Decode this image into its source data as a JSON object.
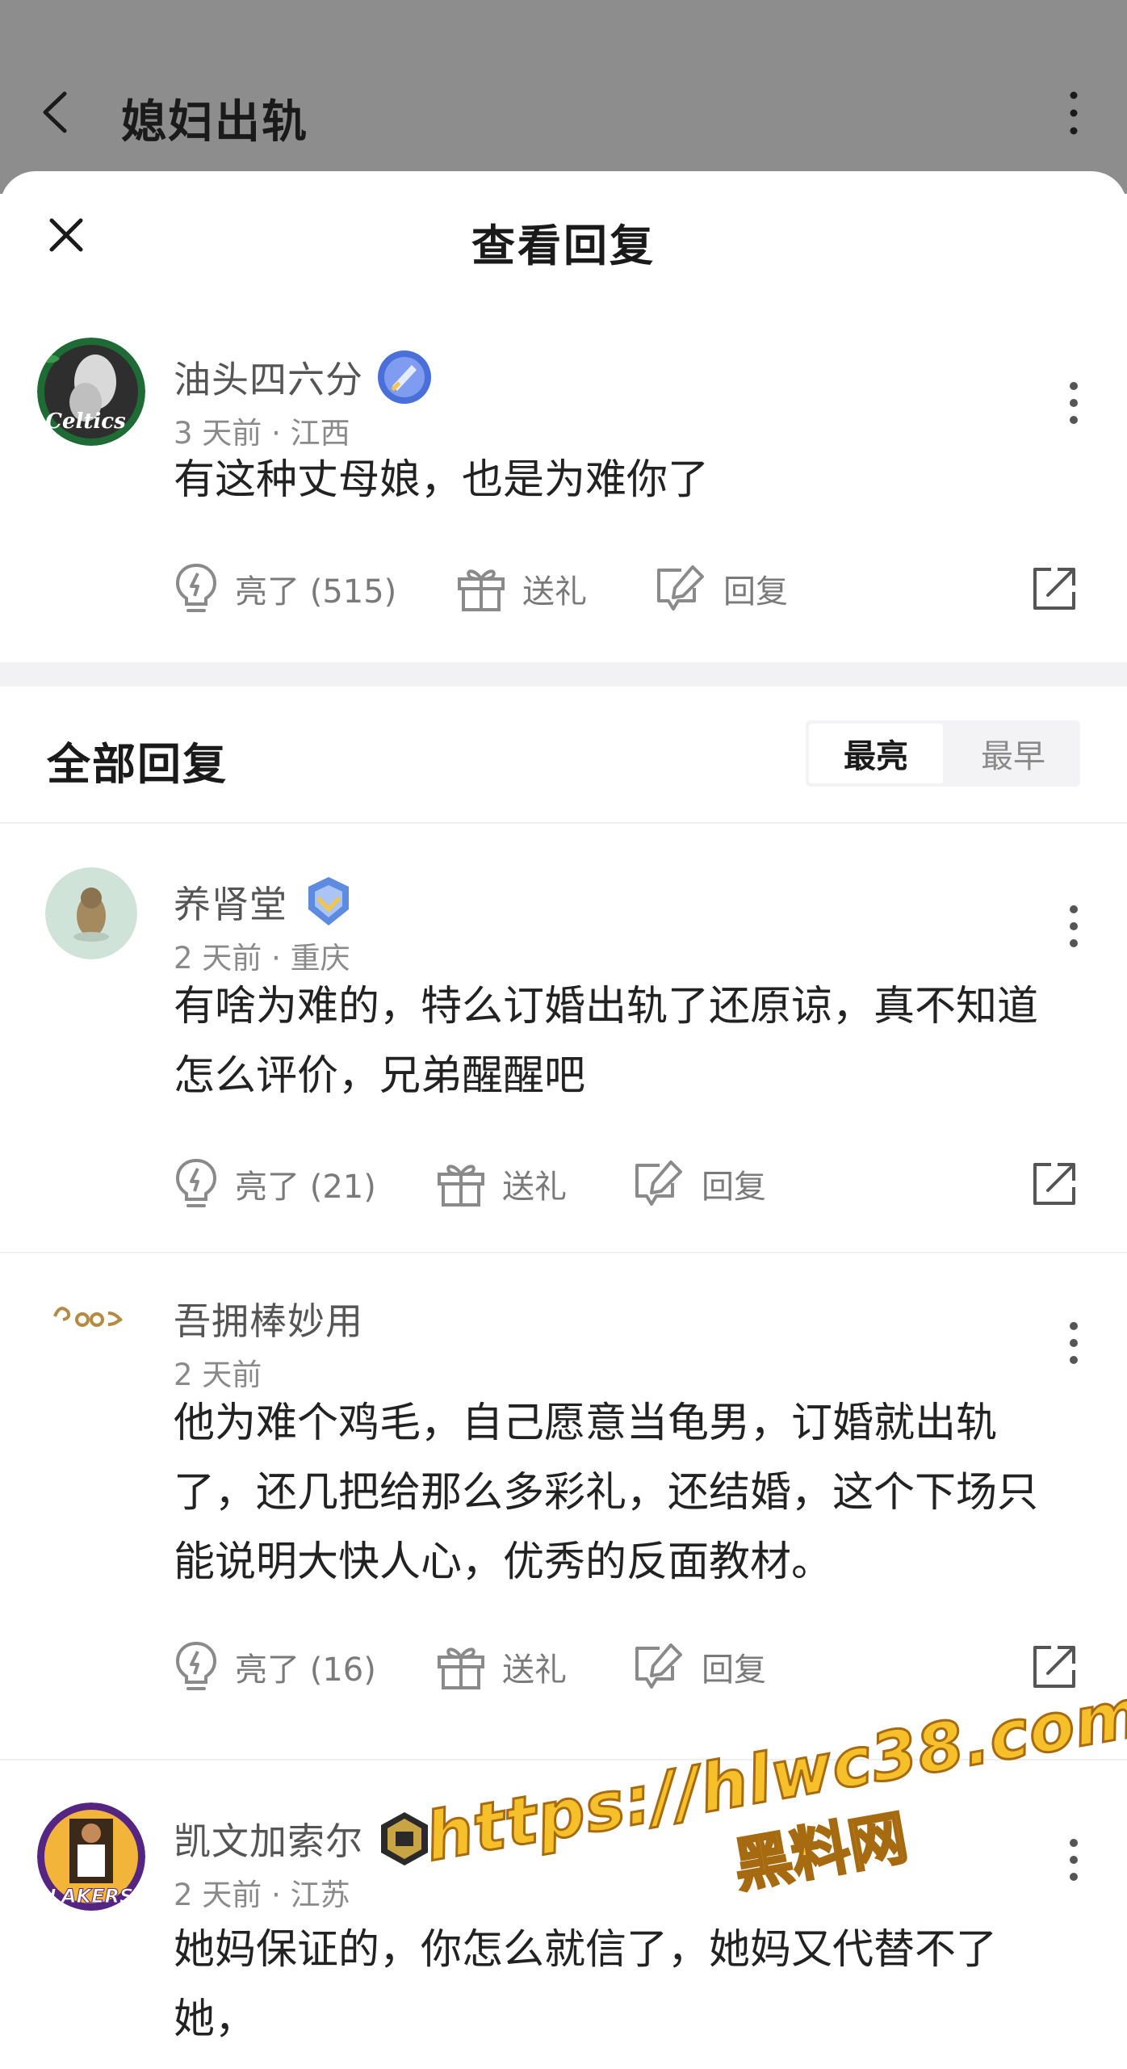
{
  "background_header": {
    "title": "媳妇出轨"
  },
  "sheet": {
    "title": "查看回复"
  },
  "main_comment": {
    "username": "油头四六分",
    "time_location": "3 天前 · 江西",
    "text": "有这种丈母娘，也是为难你了",
    "like_label": "亮了 (515)",
    "gift_label": "送礼",
    "reply_label": "回复",
    "avatar_text": "Celtics"
  },
  "replies_section": {
    "title": "全部回复",
    "sort_options": [
      "最亮",
      "最早"
    ],
    "active_sort": "最亮"
  },
  "replies": [
    {
      "username": "养肾堂",
      "time_location": "2 天前 · 重庆",
      "text": "有啥为难的，特么订婚出轨了还原谅，真不知道怎么评价，兄弟醒醒吧",
      "like_label": "亮了 (21)",
      "gift_label": "送礼",
      "reply_label": "回复"
    },
    {
      "username": "吾拥棒妙用",
      "time_location": "2 天前",
      "text": "他为难个鸡毛，自己愿意当龟男，订婚就出轨了，还几把给那么多彩礼，还结婚，这个下场只能说明大快人心，优秀的反面教材。",
      "like_label": "亮了 (16)",
      "gift_label": "送礼",
      "reply_label": "回复"
    },
    {
      "username": "凯文加索尔",
      "time_location": "2 天前 · 江苏",
      "text": "她妈保证的，你怎么就信了，她妈又代替不了她，",
      "avatar_text": "LAKERS"
    }
  ],
  "watermark": {
    "url": "https://hlwc38.com",
    "brand": "黑料网"
  },
  "colors": {
    "dim_overlay": "#8d8d8d",
    "divider": "#f2f2f4",
    "meta_text": "#8a8a8a",
    "watermark_fill": "#f5c02a"
  }
}
